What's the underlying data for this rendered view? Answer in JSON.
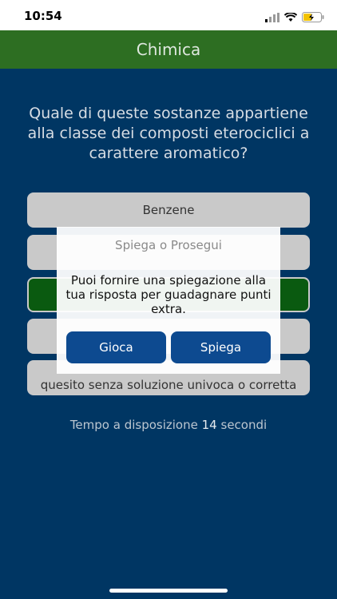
{
  "status_bar": {
    "time": "10:54"
  },
  "header": {
    "title": "Chimica"
  },
  "question": {
    "text": "Quale di queste sostanze appartiene alla classe dei composti eterociclici a carattere aromatico?"
  },
  "answers": [
    {
      "label": "Benzene"
    },
    {
      "label": ""
    },
    {
      "label": ""
    },
    {
      "label": ""
    },
    {
      "label": "quesito senza soluzione univoca o corretta"
    }
  ],
  "timer": {
    "prefix": "Tempo a disposizione",
    "seconds": "14",
    "suffix": "secondi"
  },
  "dialog": {
    "title": "Spiega o Prosegui",
    "message": "Puoi fornire una spiegazione alla tua risposta per guadagnare punti extra.",
    "play_label": "Gioca",
    "explain_label": "Spiega"
  },
  "colors": {
    "header_green": "#2d6e22",
    "background_blue": "#003663",
    "button_blue": "#0d4a90",
    "selected_green": "#0a5a10"
  }
}
